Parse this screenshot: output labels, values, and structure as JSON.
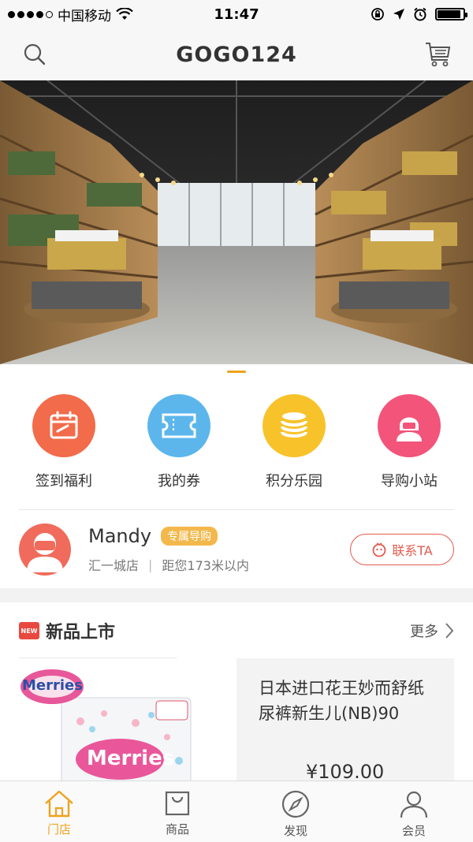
{
  "status_bar": {
    "carrier": "中国移动",
    "time": "11:47",
    "battery_level": 0.9
  },
  "nav": {
    "title": "GOGO124",
    "search_icon": "search-icon",
    "cart_icon": "cart-icon"
  },
  "banner": {
    "description_icon": "store-photo",
    "active_index": 0
  },
  "quick_actions": [
    {
      "label": "签到福利",
      "icon": "calendar-icon",
      "color": "#f26b4a"
    },
    {
      "label": "我的券",
      "icon": "coupon-icon",
      "color": "#5cb6ec"
    },
    {
      "label": "积分乐园",
      "icon": "coins-icon",
      "color": "#f8c22a"
    },
    {
      "label": "导购小站",
      "icon": "guide-icon",
      "color": "#f2547a"
    }
  ],
  "guide": {
    "name": "Mandy",
    "badge": "专属导购",
    "store": "汇一城店",
    "distance": "距您173米以内",
    "contact_label": "联系TA"
  },
  "new_products": {
    "title": "新品上市",
    "badge": "NEW",
    "more": "更多",
    "items": [
      {
        "name": "日本进口花王妙而舒纸尿裤新生儿(NB)90",
        "price": "¥109.00",
        "brand": "Merries"
      }
    ]
  },
  "tabs": [
    {
      "label": "门店",
      "icon": "home-icon",
      "active": true
    },
    {
      "label": "商品",
      "icon": "bag-icon",
      "active": false
    },
    {
      "label": "发现",
      "icon": "compass-icon",
      "active": false
    },
    {
      "label": "会员",
      "icon": "user-icon",
      "active": false
    }
  ],
  "colors": {
    "accent": "#f0a21e",
    "contact": "#e35b4f"
  }
}
